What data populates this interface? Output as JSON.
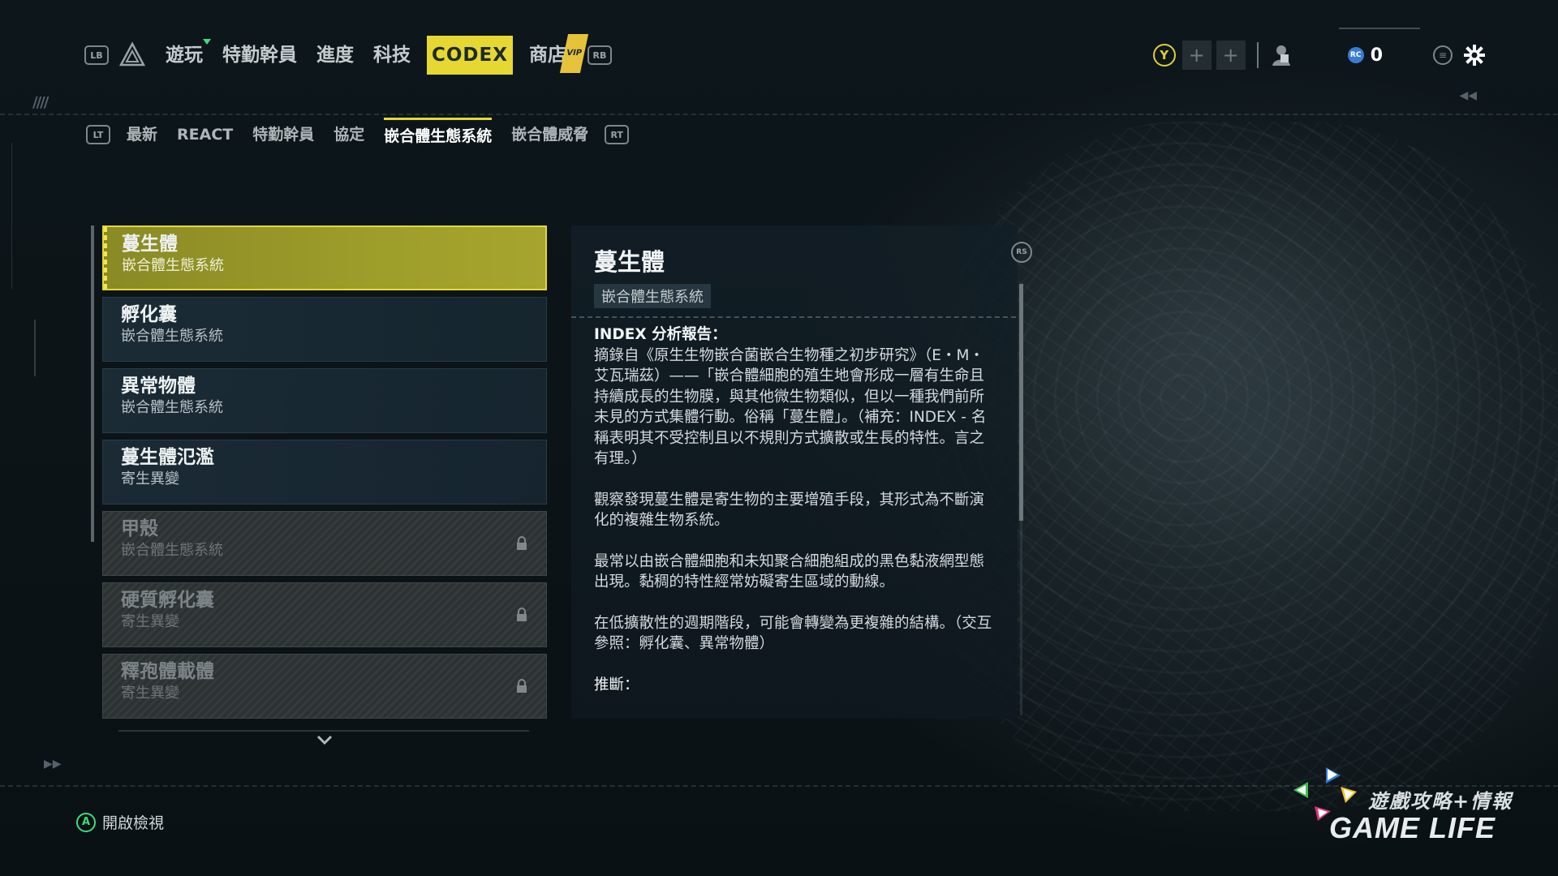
{
  "top_nav": {
    "lb": "LB",
    "rb": "RB",
    "items": [
      {
        "label": "遊玩"
      },
      {
        "label": "特勤幹員"
      },
      {
        "label": "進度"
      },
      {
        "label": "科技"
      },
      {
        "label": "CODEX"
      },
      {
        "label": "商店"
      }
    ],
    "vip_label": "VIP",
    "active_index": 4
  },
  "top_right": {
    "y_label": "Y",
    "plus_label": "+",
    "currency_badge": "RC",
    "currency_value": "0",
    "menu_label": "≡"
  },
  "sub_nav": {
    "lt": "LT",
    "rt": "RT",
    "items": [
      {
        "label": "最新"
      },
      {
        "label": "REACT"
      },
      {
        "label": "特勤幹員"
      },
      {
        "label": "協定"
      },
      {
        "label": "嵌合體生態系統"
      },
      {
        "label": "嵌合體威脅"
      }
    ],
    "active_index": 4
  },
  "list": {
    "items": [
      {
        "title": "蔓生體",
        "subtitle": "嵌合體生態系統",
        "state": "selected"
      },
      {
        "title": "孵化囊",
        "subtitle": "嵌合體生態系統",
        "state": "normal"
      },
      {
        "title": "異常物體",
        "subtitle": "嵌合體生態系統",
        "state": "normal"
      },
      {
        "title": "蔓生體氾濫",
        "subtitle": "寄生異變",
        "state": "normal"
      },
      {
        "title": "甲殼",
        "subtitle": "嵌合體生態系統",
        "state": "locked"
      },
      {
        "title": "硬質孵化囊",
        "subtitle": "寄生異變",
        "state": "locked"
      },
      {
        "title": "釋孢體載體",
        "subtitle": "寄生異變",
        "state": "locked"
      }
    ]
  },
  "detail": {
    "title": "蔓生體",
    "tag": "嵌合體生態系統",
    "rs_label": "RS",
    "heading": "INDEX 分析報告：",
    "paragraphs": [
      "摘錄自《原生生物嵌合菌嵌合生物種之初步研究》（E・M・艾瓦瑞茲）——「嵌合體細胞的殖生地會形成一層有生命且持續成長的生物膜，與其他微生物類似，但以一種我們前所未見的方式集體行動。俗稱「蔓生體」。（補充：INDEX - 名稱表明其不受控制且以不規則方式擴散或生長的特性。言之有理。）",
      "觀察發現蔓生體是寄生物的主要增殖手段，其形式為不斷演化的複雜生物系統。",
      "最常以由嵌合體細胞和未知聚合細胞組成的黑色黏液網型態出現。黏稠的特性經常妨礙寄生區域的動線。",
      "在低擴散性的週期階段，可能會轉變為更複雜的結構。（交互參照：孵化囊、異常物體）",
      "推斷："
    ]
  },
  "bottom_hint": {
    "button": "A",
    "label": "開啟檢視"
  },
  "watermark": {
    "zh": "遊戲攻略+情報",
    "en": "GAME LIFE"
  },
  "colors": {
    "accent_yellow": "#e6d733",
    "a_button_green": "#3fdc7a",
    "rc_blue": "#3b7bd4"
  }
}
